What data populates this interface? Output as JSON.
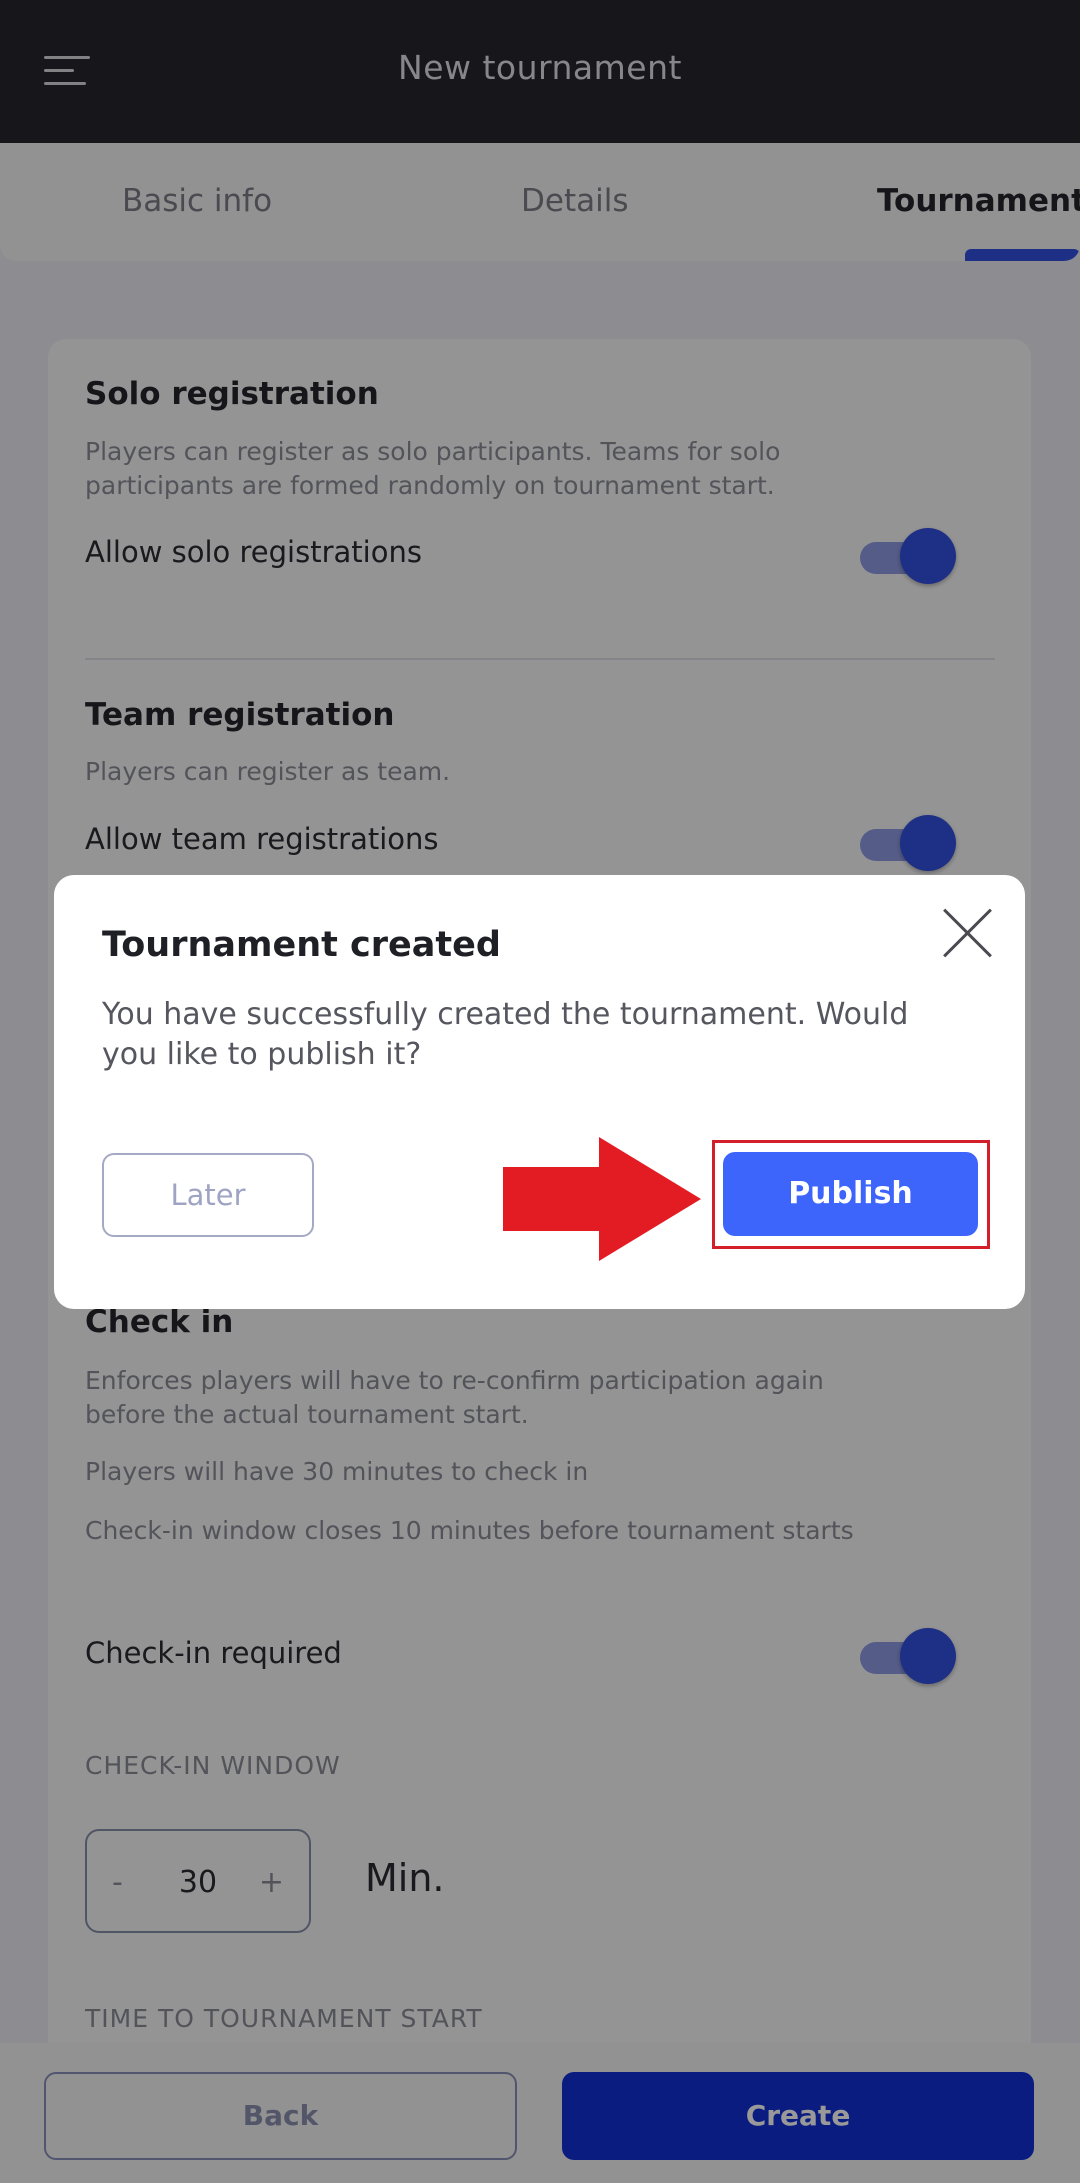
{
  "header": {
    "title": "New tournament"
  },
  "tabs": [
    {
      "label": "Basic info"
    },
    {
      "label": "Details"
    },
    {
      "label": "Tournament"
    }
  ],
  "solo": {
    "title": "Solo registration",
    "desc": "Players can register as solo participants. Teams for solo participants are formed randomly on tournament start.",
    "toggle_label": "Allow solo registrations"
  },
  "team": {
    "title": "Team registration",
    "desc": "Players can register as team.",
    "toggle_label": "Allow team registrations"
  },
  "checkin": {
    "title": "Check in",
    "desc1": "Enforces players will have to re-confirm participation again before the actual tournament start.",
    "desc2": "Players will have 30 minutes to check in",
    "desc3": "Check-in window closes 10 minutes before tournament starts",
    "toggle_label": "Check-in required",
    "window_label": "CHECK-IN WINDOW",
    "stepper": {
      "minus": "-",
      "value": "30",
      "plus": "+"
    },
    "unit": "Min.",
    "time_label": "TIME TO TOURNAMENT START"
  },
  "footer": {
    "back": "Back",
    "create": "Create"
  },
  "modal": {
    "title": "Tournament created",
    "message": "You have successfully created the tournament. Would you like to publish it?",
    "later": "Later",
    "publish": "Publish"
  },
  "colors": {
    "accent": "#3350e0",
    "publish": "#3d64fb",
    "create": "#1330d8",
    "annotation_red": "#e31b23"
  },
  "icons": [
    "menu-icon",
    "close-icon",
    "arrow-right-icon"
  ]
}
